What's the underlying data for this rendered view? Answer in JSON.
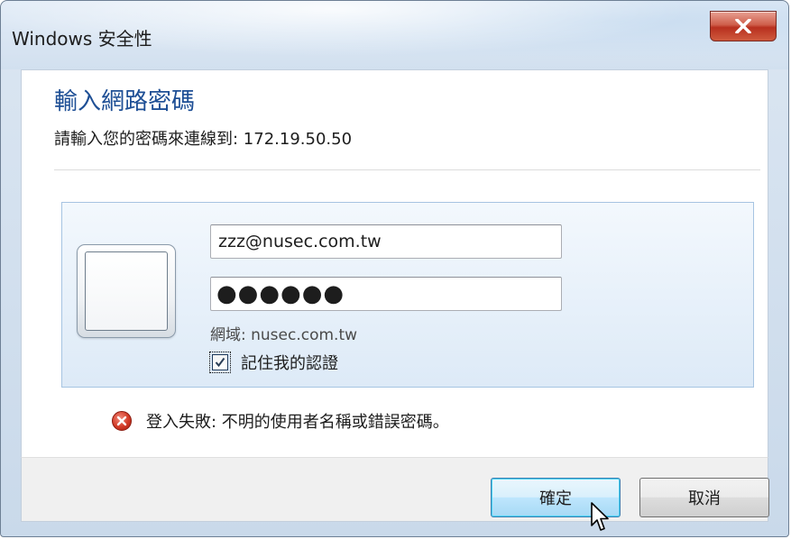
{
  "window": {
    "title": "Windows 安全性"
  },
  "dialog": {
    "heading": "輸入網路密碼",
    "subtitle": "請輸入您的密碼來連線到: 172.19.50.50",
    "username": "zzz@nusec.com.tw",
    "password_mask": "●●●●●●",
    "domain": "網域: nusec.com.tw",
    "remember_label": "記住我的認證",
    "remember_checked": true,
    "error": "登入失敗: 不明的使用者名稱或錯誤密碼。"
  },
  "buttons": {
    "ok": "確定",
    "cancel": "取消"
  },
  "icons": {
    "close": "close-icon",
    "error": "error-icon",
    "checkbox": "checkmark-icon",
    "user_tile": "user-tile-icon",
    "cursor": "mouse-pointer-icon"
  },
  "colors": {
    "heading": "#1e4f95",
    "close_button": "#c4412b",
    "error": "#d23a26",
    "ok_button_border": "#3c7fb1"
  }
}
